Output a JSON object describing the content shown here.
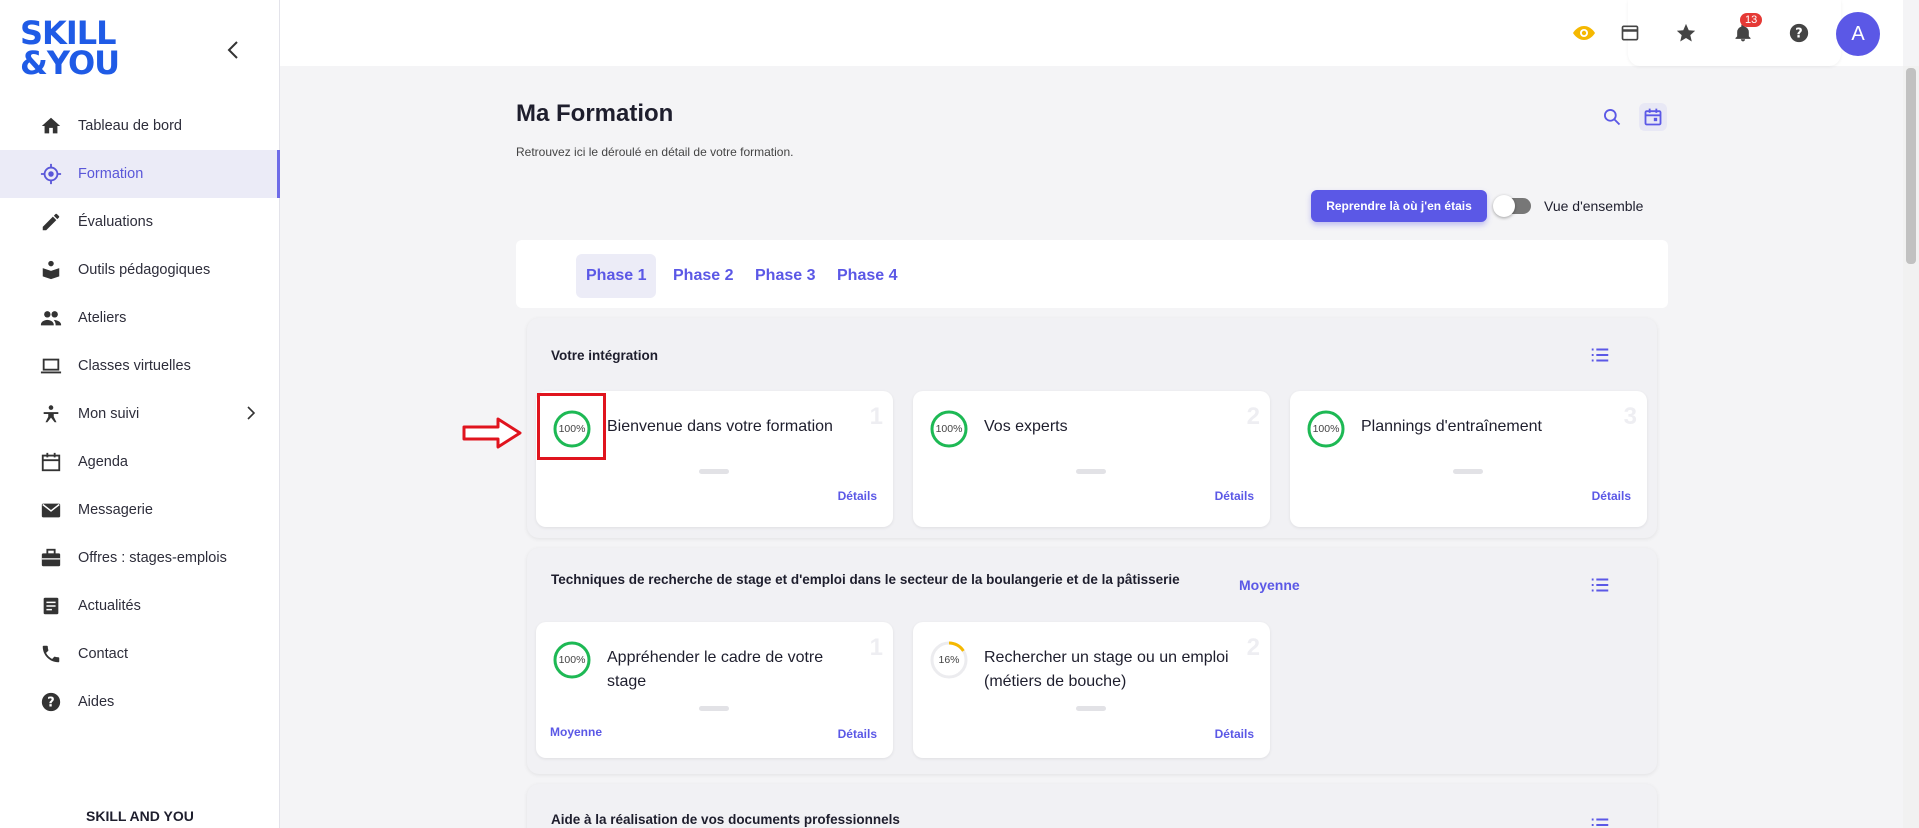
{
  "brand": {
    "logo_line1": "SKILL",
    "logo_line2": "&YOU",
    "footer": "SKILL AND YOU"
  },
  "sidebar": {
    "items": [
      {
        "label": "Tableau de bord",
        "icon": "home-icon"
      },
      {
        "label": "Formation",
        "icon": "target-icon",
        "active": true
      },
      {
        "label": "Évaluations",
        "icon": "pencil-icon"
      },
      {
        "label": "Outils pédagogiques",
        "icon": "book-reader-icon"
      },
      {
        "label": "Ateliers",
        "icon": "group-icon"
      },
      {
        "label": "Classes virtuelles",
        "icon": "laptop-icon"
      },
      {
        "label": "Mon suivi",
        "icon": "person-icon",
        "has_chevron": true
      },
      {
        "label": "Agenda",
        "icon": "calendar-icon"
      },
      {
        "label": "Messagerie",
        "icon": "mail-icon"
      },
      {
        "label": "Offres : stages-emplois",
        "icon": "briefcase-icon"
      },
      {
        "label": "Actualités",
        "icon": "news-icon"
      },
      {
        "label": "Contact",
        "icon": "phone-icon"
      },
      {
        "label": "Aides",
        "icon": "help-icon"
      }
    ]
  },
  "topbar": {
    "notification_count": "13",
    "avatar_initial": "A"
  },
  "page": {
    "title": "Ma Formation",
    "subtitle": "Retrouvez ici le déroulé en détail de votre formation.",
    "resume_button": "Reprendre là où j'en étais",
    "overview_toggle_label": "Vue d'ensemble"
  },
  "tabs": [
    "Phase 1",
    "Phase 2",
    "Phase 3",
    "Phase 4"
  ],
  "colors": {
    "accent": "#5b58e6",
    "complete": "#1db954",
    "partial": "#f5b800",
    "highlight": "#e0141e"
  },
  "sections": [
    {
      "title": "Votre intégration",
      "level": "",
      "cards": [
        {
          "title": "Bienvenue dans votre formation",
          "progress": "100%",
          "progress_value": 100,
          "number": "1",
          "details": "Détails",
          "level": ""
        },
        {
          "title": "Vos experts",
          "progress": "100%",
          "progress_value": 100,
          "number": "2",
          "details": "Détails",
          "level": ""
        },
        {
          "title": "Plannings d'entraînement",
          "progress": "100%",
          "progress_value": 100,
          "number": "3",
          "details": "Détails",
          "level": ""
        }
      ]
    },
    {
      "title": "Techniques de recherche de stage et d'emploi dans le secteur de la boulangerie et de la pâtisserie",
      "level": "Moyenne",
      "cards": [
        {
          "title": "Appréhender le cadre de votre stage",
          "progress": "100%",
          "progress_value": 100,
          "number": "1",
          "details": "Détails",
          "level": "Moyenne"
        },
        {
          "title": "Rechercher un stage ou un emploi (métiers de bouche)",
          "progress": "16%",
          "progress_value": 16,
          "number": "2",
          "details": "Détails",
          "level": ""
        }
      ]
    },
    {
      "title": "Aide à la réalisation de vos documents professionnels",
      "level": "",
      "cards": []
    }
  ]
}
